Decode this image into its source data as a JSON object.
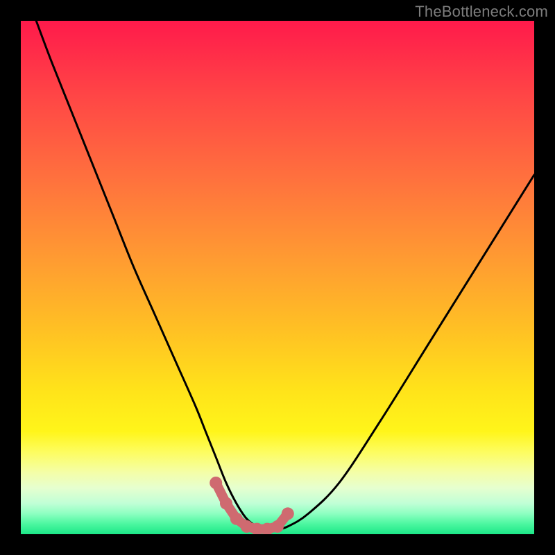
{
  "meta": {
    "watermark": "TheBottleneck.com"
  },
  "colors": {
    "background_black": "#000000",
    "curve_black": "#000000",
    "marker_pink": "#cf6a70",
    "gradient_stops": [
      {
        "pct": 0,
        "hex": "#ff1a4b"
      },
      {
        "pct": 14,
        "hex": "#ff4446"
      },
      {
        "pct": 30,
        "hex": "#ff6f3e"
      },
      {
        "pct": 46,
        "hex": "#ff9a32"
      },
      {
        "pct": 60,
        "hex": "#ffc024"
      },
      {
        "pct": 72,
        "hex": "#ffe31a"
      },
      {
        "pct": 80,
        "hex": "#fff51a"
      },
      {
        "pct": 84,
        "hex": "#fdfd60"
      },
      {
        "pct": 88,
        "hex": "#f4fea8"
      },
      {
        "pct": 91,
        "hex": "#e6ffcf"
      },
      {
        "pct": 94,
        "hex": "#c0ffd6"
      },
      {
        "pct": 96,
        "hex": "#8dffc1"
      },
      {
        "pct": 98,
        "hex": "#4cf7a0"
      },
      {
        "pct": 100,
        "hex": "#1ce788"
      }
    ]
  },
  "chart_data": {
    "type": "line",
    "title": "",
    "xlabel": "",
    "ylabel": "",
    "xlim": [
      0,
      100
    ],
    "ylim": [
      0,
      100
    ],
    "grid": false,
    "legend": false,
    "series": [
      {
        "name": "bottleneck-curve",
        "x": [
          3,
          6,
          10,
          14,
          18,
          22,
          26,
          30,
          34,
          36,
          38,
          40,
          42,
          44,
          46,
          48,
          50,
          52,
          56,
          62,
          70,
          80,
          90,
          100
        ],
        "y": [
          100,
          92,
          82,
          72,
          62,
          52,
          43,
          34,
          25,
          20,
          15,
          10,
          6,
          3,
          1.5,
          1,
          1,
          1.5,
          4,
          10,
          22,
          38,
          54,
          70
        ]
      }
    ],
    "markers": {
      "name": "bottom-cluster",
      "x": [
        38,
        40,
        42,
        44,
        46,
        48,
        50,
        52
      ],
      "y": [
        10,
        6,
        3,
        1.5,
        1,
        1,
        1.5,
        4
      ]
    }
  }
}
